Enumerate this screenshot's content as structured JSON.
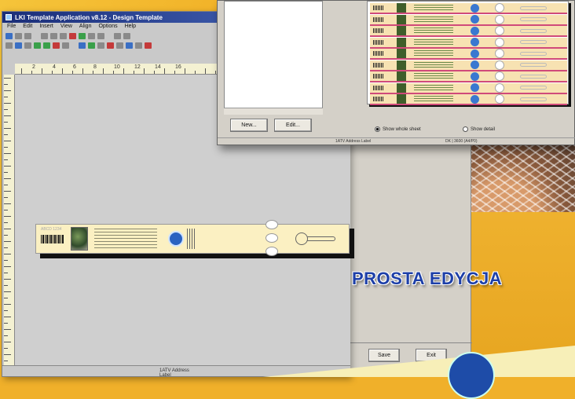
{
  "app": {
    "title": "LKI Template Application v8.12 - Design Template",
    "menu": [
      "File",
      "Edit",
      "Insert",
      "View",
      "Align",
      "Options",
      "Help"
    ],
    "status": "1ATV Address Label"
  },
  "ruler": {
    "h_labels": [
      "2",
      "4",
      "6",
      "8",
      "10",
      "12",
      "14",
      "16"
    ]
  },
  "label": {
    "small_text": "ABCD 1234"
  },
  "dialog": {
    "new_label": "New...",
    "edit_label": "Edit...",
    "radio_whole": "Show whole sheet",
    "radio_detail": "Show detail",
    "status_left": "1ATV Address Label",
    "status_right": "DK | 3600 (A4/P0)"
  },
  "panel": {
    "save_label": "Save",
    "exit_label": "Exit"
  },
  "banner": {
    "text": "PROSTA EDYCJA",
    "color": "#1d3fa8"
  }
}
